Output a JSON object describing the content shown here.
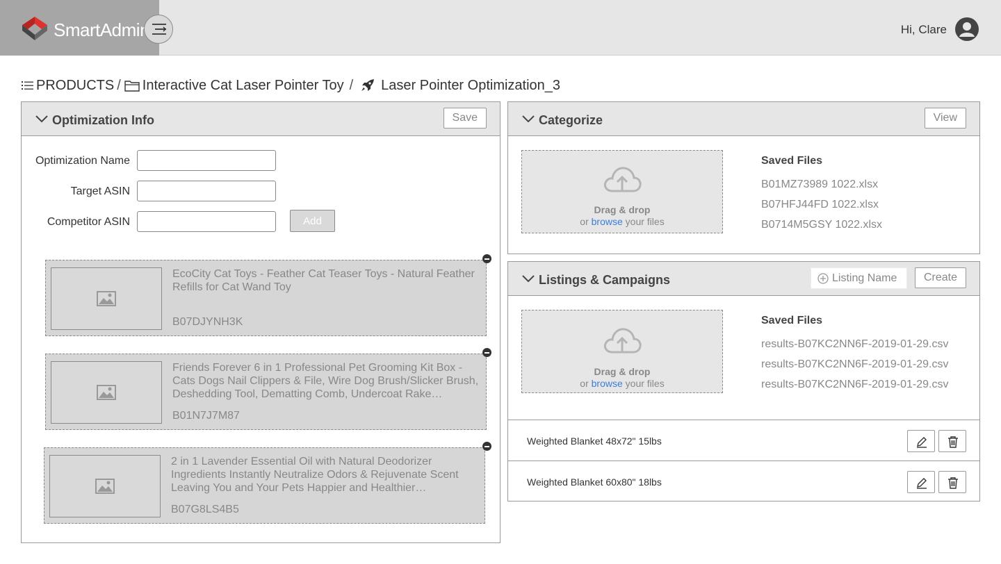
{
  "app": {
    "brand": "SmartAdmin",
    "greeting": "Hi, Clare"
  },
  "breadcrumb": {
    "items": [
      "PRODUCTS",
      "Interactive Cat Laser Pointer Toy",
      "Laser Pointer Optimization_3"
    ],
    "separator": "/"
  },
  "optimization_info": {
    "title": "Optimization Info",
    "save_label": "Save",
    "fields": {
      "name_label": "Optimization Name",
      "name_value": "",
      "target_label": "Target ASIN",
      "target_value": "",
      "competitor_label": "Competitor ASIN",
      "competitor_value": ""
    },
    "add_label": "Add",
    "competitors": [
      {
        "title": "EcoCity Cat Toys - Feather Cat Teaser Toys - Natural Feather Refills for Cat Wand Toy",
        "asin": "B07DJYNH3K"
      },
      {
        "title": "Friends Forever 6 in 1 Professional Pet Grooming Kit Box - Cats Dogs Nail Clippers & File, Wire Dog Brush/Slicker Brush, Deshedding Tool, Dematting Comb, Undercoat Rake…",
        "asin": "B01N7J7M87"
      },
      {
        "title": "2 in 1 Lavender Essential Oil with Natural Deodorizer Ingredients Instantly Neutralize Odors & Rejuvenate Scent Leaving You and Your Pets Happier and Healthier…",
        "asin": "B07G8LS4B5"
      }
    ]
  },
  "categorize": {
    "title": "Categorize",
    "view_label": "View",
    "dropzone": {
      "title": "Drag & drop",
      "prefix": "or",
      "link": "browse",
      "suffix": "your files"
    },
    "saved_files_title": "Saved Files",
    "files": [
      "B01MZ73989 1022.xlsx",
      "B07HFJ44FD 1022.xlsx",
      "B0714M5GSY 1022.xlsx"
    ]
  },
  "listings": {
    "title": "Listings & Campaigns",
    "listing_name_placeholder": "Listing Name",
    "create_label": "Create",
    "dropzone": {
      "title": "Drag & drop",
      "prefix": "or",
      "link": "browse",
      "suffix": "your files"
    },
    "saved_files_title": "Saved Files",
    "files": [
      "results-B07KC2NN6F-2019-01-29.csv",
      "results-B07KC2NN6F-2019-01-29.csv",
      "results-B07KC2NN6F-2019-01-29.csv"
    ],
    "rows": [
      {
        "label": "Weighted Blanket 48x72\" 15lbs"
      },
      {
        "label": "Weighted Blanket 60x80\" 18lbs"
      }
    ]
  },
  "icons": {
    "logo": "smartadmin-logo-icon",
    "menu": "menu-toggle-icon",
    "user": "user-avatar-icon",
    "list": "list-icon",
    "folder": "folder-icon",
    "rocket": "rocket-icon",
    "chevron": "chevron-down-icon",
    "image": "image-placeholder-icon",
    "upload": "cloud-upload-icon",
    "add": "plus-circle-icon",
    "edit": "pencil-icon",
    "delete": "trash-icon"
  },
  "colors": {
    "topbar": "#e6e6e6",
    "brand_bg": "#a6a6a6",
    "logo_red": "#e0312d",
    "logo_dark": "#444444",
    "link": "#3b7dd8"
  }
}
